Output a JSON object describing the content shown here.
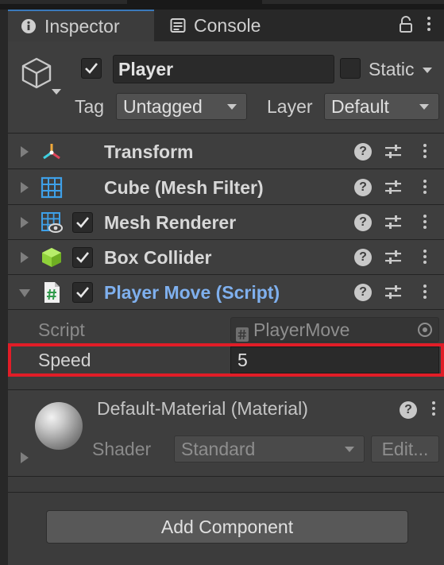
{
  "tabs": {
    "inspector_label": "Inspector",
    "console_label": "Console"
  },
  "object": {
    "active_checked": true,
    "name": "Player",
    "static_label": "Static",
    "static_checked": false,
    "tag_label": "Tag",
    "tag_value": "Untagged",
    "layer_label": "Layer",
    "layer_value": "Default"
  },
  "components": [
    {
      "name": "Transform",
      "icon": "transform-icon",
      "has_checkbox": false
    },
    {
      "name": "Cube (Mesh Filter)",
      "icon": "mesh-filter-icon",
      "has_checkbox": false
    },
    {
      "name": "Mesh Renderer",
      "icon": "mesh-renderer-icon",
      "has_checkbox": true,
      "checked": true
    },
    {
      "name": "Box Collider",
      "icon": "box-collider-icon",
      "has_checkbox": true,
      "checked": true
    },
    {
      "name": "Player Move (Script)",
      "icon": "script-icon",
      "has_checkbox": true,
      "checked": true,
      "expanded": true
    }
  ],
  "script_props": {
    "script_label": "Script",
    "script_value": "PlayerMove",
    "speed_label": "Speed",
    "speed_value": "5"
  },
  "material": {
    "name": "Default-Material (Material)",
    "shader_label": "Shader",
    "shader_value": "Standard",
    "edit_label": "Edit..."
  },
  "add_component_label": "Add Component",
  "colors": {
    "highlight": "#e11d27",
    "script_title": "#7fb0ee",
    "tab_accent": "#3a79bb"
  }
}
